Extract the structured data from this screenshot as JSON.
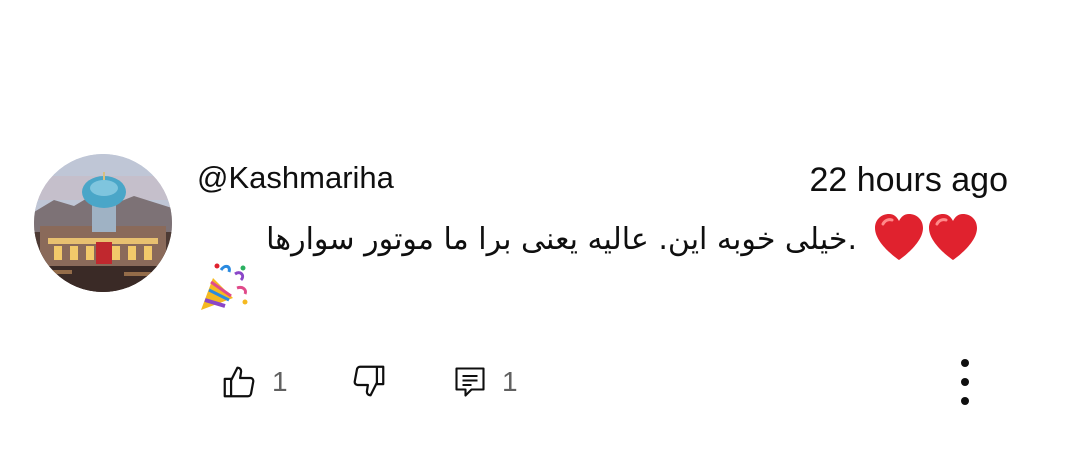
{
  "comment": {
    "username": "@Kashmariha",
    "timestamp": "22 hours ago",
    "text": ".خیلی خوبه این. عالیه یعنی برا ما موتور سوارها",
    "emoji_hearts": [
      "red-heart",
      "red-heart"
    ],
    "emoji_trailing": "party-popper"
  },
  "actions": {
    "like_count": "1",
    "reply_count": "1"
  },
  "icons": {
    "like": "thumbs-up-icon",
    "dislike": "thumbs-down-icon",
    "reply": "reply-icon",
    "more": "more-vertical-icon"
  },
  "colors": {
    "text": "#0f0f0f",
    "secondary": "#606060",
    "heart": "#e0222e"
  }
}
